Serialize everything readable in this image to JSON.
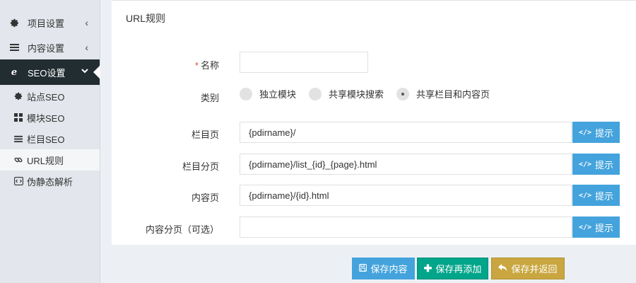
{
  "sidebar": {
    "items": [
      {
        "label": "项目设置",
        "icon": "gear-icon",
        "chevron": "‹"
      },
      {
        "label": "内容设置",
        "icon": "list-icon",
        "chevron": "‹"
      },
      {
        "label": "SEO设置",
        "icon": "ie-icon",
        "chevron": "⌄"
      }
    ],
    "subitems": [
      {
        "label": "站点SEO",
        "icon": "gear-icon"
      },
      {
        "label": "模块SEO",
        "icon": "grid-icon"
      },
      {
        "label": "栏目SEO",
        "icon": "list-icon"
      },
      {
        "label": "URL规则",
        "icon": "link-icon"
      },
      {
        "label": "伪静态解析",
        "icon": "code-icon"
      }
    ]
  },
  "panel": {
    "title": "URL规则",
    "name": {
      "label": "名称",
      "required_mark": "*",
      "value": ""
    },
    "type": {
      "label": "类别",
      "options": [
        "独立模块",
        "共享模块搜索",
        "共享栏目和内容页"
      ],
      "selected": "共享栏目和内容页"
    },
    "fields": [
      {
        "label": "栏目页",
        "value": "{pdirname}/"
      },
      {
        "label": "栏目分页",
        "value": "{pdirname}/list_{id}_{page}.html"
      },
      {
        "label": "内容页",
        "value": "{pdirname}/{id}.html"
      },
      {
        "label": "内容分页（可选）",
        "value": ""
      }
    ],
    "hint_label": "提示"
  },
  "footer": {
    "save_label": "保存内容",
    "save_add_label": "保存再添加",
    "save_back_label": "保存并返回"
  },
  "colors": {
    "sidebar_active": "#222d32",
    "primary": "#44a3dc",
    "success": "#00a58a",
    "warning": "#c9a63f"
  }
}
